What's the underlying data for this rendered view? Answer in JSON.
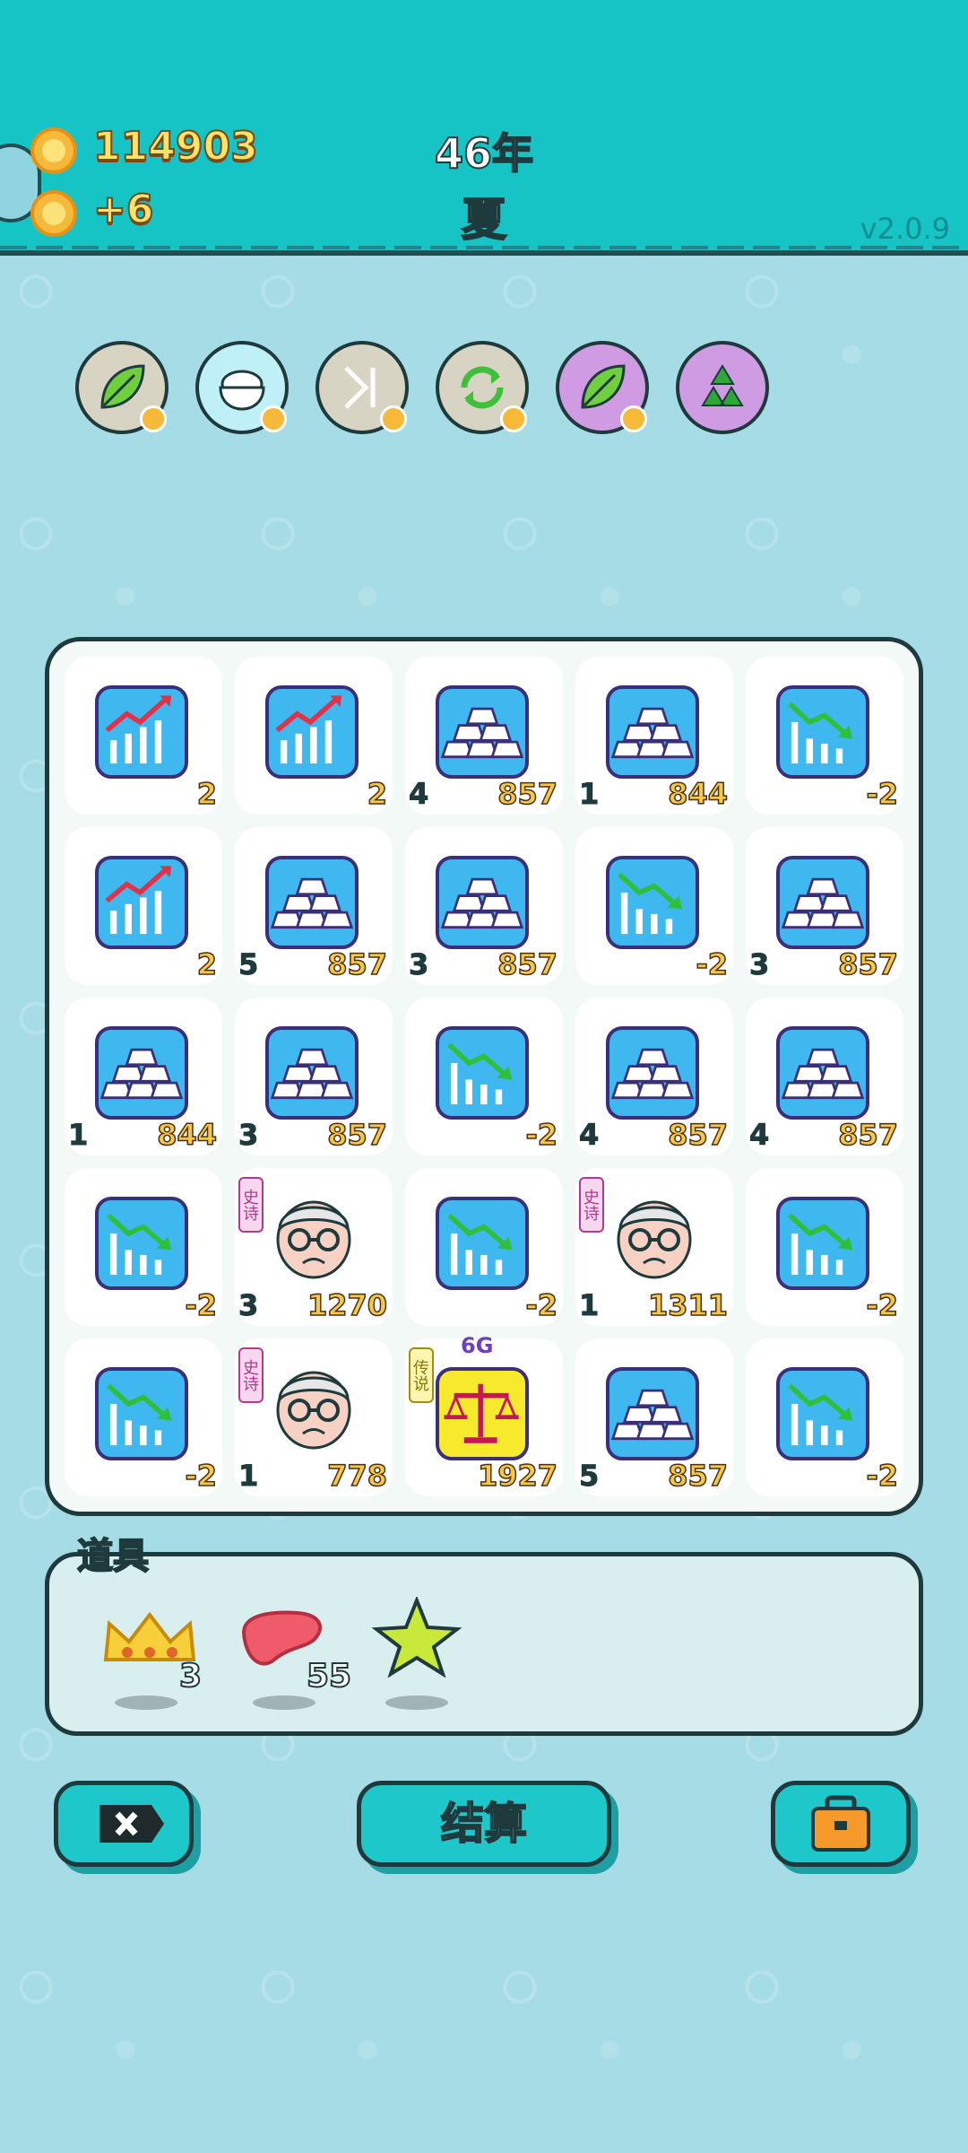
{
  "header": {
    "coins": "114903",
    "income": "+6",
    "year": "46年",
    "season": "夏",
    "version": "v2.0.9"
  },
  "skills": [
    {
      "name": "leaf-icon",
      "bg": "#d8d4c4"
    },
    {
      "name": "rice-bowl-icon",
      "bg": "#bff0f7"
    },
    {
      "name": "skip-icon",
      "bg": "#d8d4c4"
    },
    {
      "name": "refresh-icon",
      "bg": "#d8d4c4"
    },
    {
      "name": "leaf-icon",
      "bg": "#cf9be3"
    },
    {
      "name": "recycle-icon",
      "bg": "#cf9be3"
    }
  ],
  "board": {
    "rows": [
      [
        {
          "icon": "chart-up-icon",
          "left": "",
          "right": "2"
        },
        {
          "icon": "chart-up-icon",
          "left": "",
          "right": "2"
        },
        {
          "icon": "gold-bars-icon",
          "left": "4",
          "right": "857"
        },
        {
          "icon": "gold-bars-icon",
          "left": "1",
          "right": "844"
        },
        {
          "icon": "chart-down-icon",
          "left": "",
          "right": "-2"
        }
      ],
      [
        {
          "icon": "chart-up-icon",
          "left": "",
          "right": "2"
        },
        {
          "icon": "gold-bars-icon",
          "left": "5",
          "right": "857"
        },
        {
          "icon": "gold-bars-icon",
          "left": "3",
          "right": "857"
        },
        {
          "icon": "chart-down-icon",
          "left": "",
          "right": "-2"
        },
        {
          "icon": "gold-bars-icon",
          "left": "3",
          "right": "857"
        }
      ],
      [
        {
          "icon": "gold-bars-icon",
          "left": "1",
          "right": "844"
        },
        {
          "icon": "gold-bars-icon",
          "left": "3",
          "right": "857"
        },
        {
          "icon": "chart-down-icon",
          "left": "",
          "right": "-2"
        },
        {
          "icon": "gold-bars-icon",
          "left": "4",
          "right": "857"
        },
        {
          "icon": "gold-bars-icon",
          "left": "4",
          "right": "857"
        }
      ],
      [
        {
          "icon": "chart-down-icon",
          "left": "",
          "right": "-2"
        },
        {
          "icon": "old-man-icon",
          "left": "3",
          "right": "1270",
          "tag": "史诗"
        },
        {
          "icon": "chart-down-icon",
          "left": "",
          "right": "-2"
        },
        {
          "icon": "old-man-icon",
          "left": "1",
          "right": "1311",
          "tag": "史诗"
        },
        {
          "icon": "chart-down-icon",
          "left": "",
          "right": "-2"
        }
      ],
      [
        {
          "icon": "chart-down-icon",
          "left": "",
          "right": "-2"
        },
        {
          "icon": "old-man-icon",
          "left": "1",
          "right": "778",
          "tag": "史诗"
        },
        {
          "icon": "scale-icon",
          "left": "",
          "right": "1927",
          "tag": "传说",
          "extra": "6G"
        },
        {
          "icon": "gold-bars-icon",
          "left": "5",
          "right": "857"
        },
        {
          "icon": "chart-down-icon",
          "left": "",
          "right": "-2"
        }
      ]
    ]
  },
  "inventory": {
    "label": "道具",
    "items": [
      {
        "icon": "crown-icon",
        "count": "3"
      },
      {
        "icon": "liver-icon",
        "count": "55"
      },
      {
        "icon": "star-icon",
        "count": ""
      }
    ]
  },
  "buttons": {
    "close_icon": "close-icon",
    "settle_label": "结算",
    "bag_icon": "briefcase-icon"
  }
}
